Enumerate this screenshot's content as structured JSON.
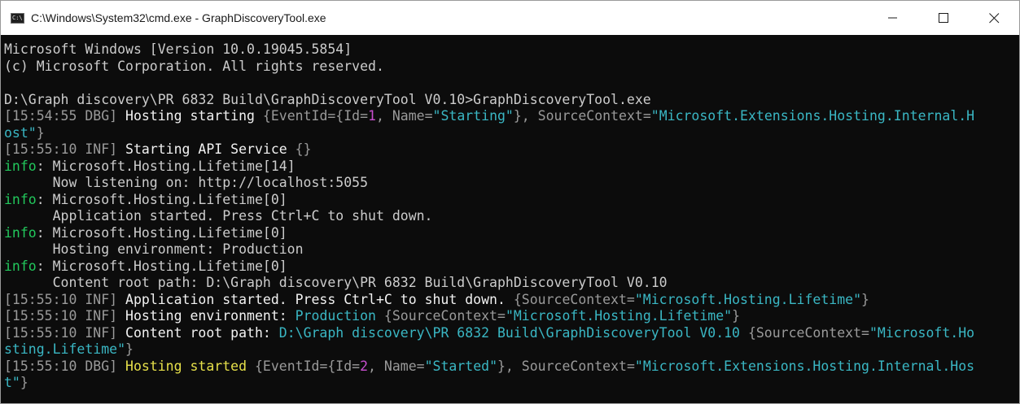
{
  "window": {
    "title": "C:\\Windows\\System32\\cmd.exe - GraphDiscoveryTool.exe",
    "icon": "cmd-icon",
    "icon_glyph": "C:\\",
    "controls": [
      {
        "name": "minimize-button",
        "icon": "minimize-icon"
      },
      {
        "name": "maximize-button",
        "icon": "maximize-icon"
      },
      {
        "name": "close-button",
        "icon": "close-icon"
      }
    ]
  },
  "colors": {
    "background": "#0c0c0c",
    "default_text": "#cccccc",
    "dim": "#9a9a9a",
    "teal": "#3ab7c4",
    "magenta": "#c94fd0",
    "green": "#22c85c",
    "yellow": "#e6e04a"
  },
  "console": {
    "lines": [
      [
        {
          "t": "Microsoft Windows [Version 10.0.19045.5854]",
          "c": "default"
        }
      ],
      [
        {
          "t": "(c) Microsoft Corporation. All rights reserved.",
          "c": "default"
        }
      ],
      [
        {
          "t": "",
          "c": "default"
        }
      ],
      [
        {
          "t": "D:\\Graph discovery\\PR 6832 Build\\GraphDiscoveryTool V0.10>GraphDiscoveryTool.exe",
          "c": "default"
        }
      ],
      [
        {
          "t": "[15:54:55 DBG] ",
          "c": "dim"
        },
        {
          "t": "Hosting starting ",
          "c": "white"
        },
        {
          "t": "{EventId={Id=",
          "c": "dim"
        },
        {
          "t": "1",
          "c": "magenta"
        },
        {
          "t": ", Name=",
          "c": "dim"
        },
        {
          "t": "\"Starting\"",
          "c": "teal"
        },
        {
          "t": "}, SourceContext=",
          "c": "dim"
        },
        {
          "t": "\"Microsoft.Extensions.Hosting.Internal.H",
          "c": "teal"
        }
      ],
      [
        {
          "t": "ost\"",
          "c": "teal"
        },
        {
          "t": "}",
          "c": "dim"
        }
      ],
      [
        {
          "t": "[15:55:10 INF] ",
          "c": "dim"
        },
        {
          "t": "Starting API Service ",
          "c": "white"
        },
        {
          "t": "{}",
          "c": "dim"
        }
      ],
      [
        {
          "t": "info",
          "c": "green"
        },
        {
          "t": ": Microsoft.Hosting.Lifetime[14]",
          "c": "default"
        }
      ],
      [
        {
          "t": "      Now listening on: http://localhost:5055",
          "c": "default"
        }
      ],
      [
        {
          "t": "info",
          "c": "green"
        },
        {
          "t": ": Microsoft.Hosting.Lifetime[0]",
          "c": "default"
        }
      ],
      [
        {
          "t": "      Application started. Press Ctrl+C to shut down.",
          "c": "default"
        }
      ],
      [
        {
          "t": "info",
          "c": "green"
        },
        {
          "t": ": Microsoft.Hosting.Lifetime[0]",
          "c": "default"
        }
      ],
      [
        {
          "t": "      Hosting environment: Production",
          "c": "default"
        }
      ],
      [
        {
          "t": "info",
          "c": "green"
        },
        {
          "t": ": Microsoft.Hosting.Lifetime[0]",
          "c": "default"
        }
      ],
      [
        {
          "t": "      Content root path: D:\\Graph discovery\\PR 6832 Build\\GraphDiscoveryTool V0.10",
          "c": "default"
        }
      ],
      [
        {
          "t": "[15:55:10 INF] ",
          "c": "dim"
        },
        {
          "t": "Application started. Press Ctrl+C to shut down. ",
          "c": "white"
        },
        {
          "t": "{SourceContext=",
          "c": "dim"
        },
        {
          "t": "\"Microsoft.Hosting.Lifetime\"",
          "c": "teal"
        },
        {
          "t": "}",
          "c": "dim"
        }
      ],
      [
        {
          "t": "[15:55:10 INF] ",
          "c": "dim"
        },
        {
          "t": "Hosting environment: ",
          "c": "white"
        },
        {
          "t": "Production ",
          "c": "teal"
        },
        {
          "t": "{SourceContext=",
          "c": "dim"
        },
        {
          "t": "\"Microsoft.Hosting.Lifetime\"",
          "c": "teal"
        },
        {
          "t": "}",
          "c": "dim"
        }
      ],
      [
        {
          "t": "[15:55:10 INF] ",
          "c": "dim"
        },
        {
          "t": "Content root path: ",
          "c": "white"
        },
        {
          "t": "D:\\Graph discovery\\PR 6832 Build\\GraphDiscoveryTool V0.10 ",
          "c": "teal"
        },
        {
          "t": "{SourceContext=",
          "c": "dim"
        },
        {
          "t": "\"Microsoft.Ho",
          "c": "teal"
        }
      ],
      [
        {
          "t": "sting.Lifetime\"",
          "c": "teal"
        },
        {
          "t": "}",
          "c": "dim"
        }
      ],
      [
        {
          "t": "[15:55:10 DBG] ",
          "c": "dim"
        },
        {
          "t": "Hosting started ",
          "c": "yellow"
        },
        {
          "t": "{EventId={Id=",
          "c": "dim"
        },
        {
          "t": "2",
          "c": "magenta"
        },
        {
          "t": ", Name=",
          "c": "dim"
        },
        {
          "t": "\"Started\"",
          "c": "teal"
        },
        {
          "t": "}, SourceContext=",
          "c": "dim"
        },
        {
          "t": "\"Microsoft.Extensions.Hosting.Internal.Hos",
          "c": "teal"
        }
      ],
      [
        {
          "t": "t\"",
          "c": "teal"
        },
        {
          "t": "}",
          "c": "dim"
        }
      ]
    ]
  }
}
